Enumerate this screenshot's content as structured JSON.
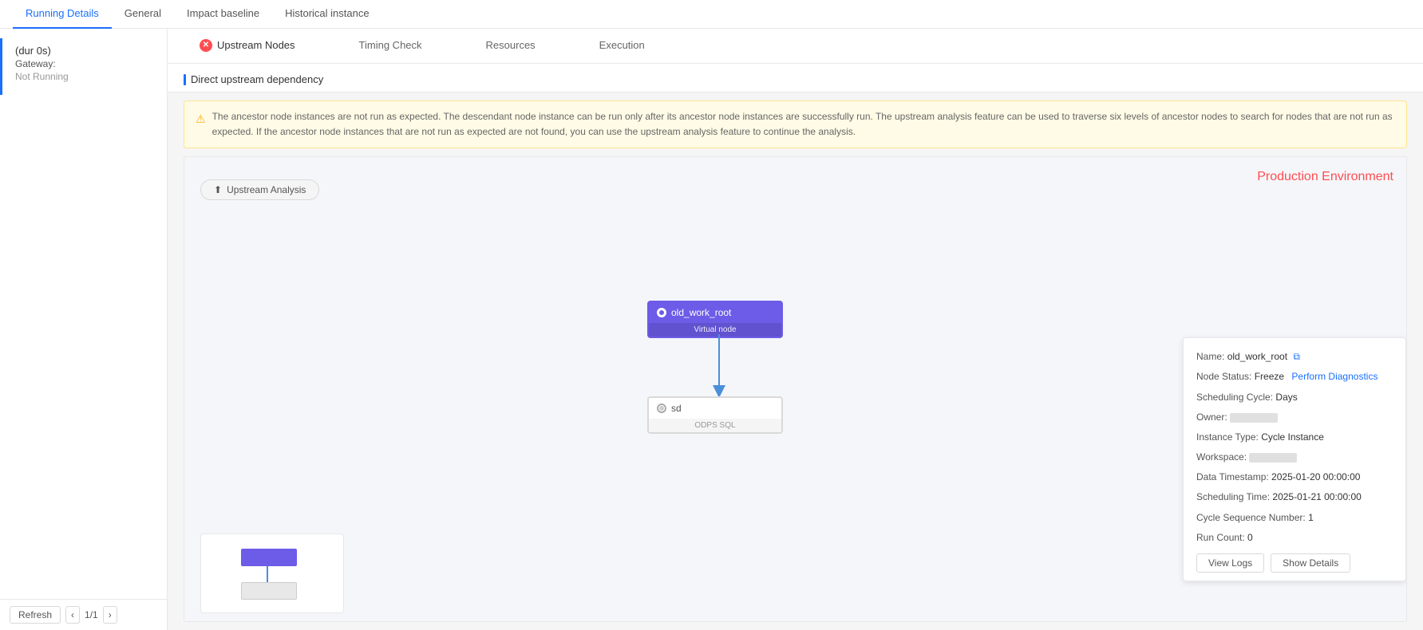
{
  "tabs": {
    "top": [
      {
        "label": "Running Details",
        "active": true
      },
      {
        "label": "General",
        "active": false
      },
      {
        "label": "Impact baseline",
        "active": false
      },
      {
        "label": "Historical instance",
        "active": false
      }
    ],
    "sub": [
      {
        "label": "Upstream Nodes",
        "active": true,
        "error": true
      },
      {
        "label": "Timing Check",
        "active": false
      },
      {
        "label": "Resources",
        "active": false
      },
      {
        "label": "Execution",
        "active": false
      }
    ]
  },
  "sidebar": {
    "dur": "(dur 0s)",
    "gateway_label": "Gateway:",
    "status": "Not Running",
    "refresh": "Refresh",
    "page": "1/1"
  },
  "dependency": {
    "section_label": "Direct upstream dependency"
  },
  "warning": {
    "text": "The ancestor node instances are not run as expected. The descendant node instance can be run only after its ancestor node instances are successfully run. The upstream analysis feature can be used to traverse six levels of ancestor nodes to search for nodes that are not run as expected. If the ancestor node instances that are not run as expected are not found, you can use the upstream analysis feature to continue the analysis."
  },
  "graph": {
    "upstream_btn": "Upstream Analysis",
    "prod_label": "Production Environment",
    "node1": {
      "name": "old_work_root",
      "type": "Virtual node"
    },
    "node2": {
      "name": "sd",
      "type": "ODPS SQL"
    }
  },
  "detail": {
    "name_label": "Name:",
    "name_val": "old_work_root",
    "node_status_label": "Node Status:",
    "node_status_val": "Freeze",
    "diagnose_link": "Perform Diagnostics",
    "sched_cycle_label": "Scheduling Cycle:",
    "sched_cycle_val": "Days",
    "owner_label": "Owner:",
    "instance_type_label": "Instance Type:",
    "instance_type_val": "Cycle Instance",
    "workspace_label": "Workspace:",
    "data_ts_label": "Data Timestamp:",
    "data_ts_val": "2025-01-20 00:00:00",
    "sched_time_label": "Scheduling Time:",
    "sched_time_val": "2025-01-21 00:00:00",
    "cycle_seq_label": "Cycle Sequence Number:",
    "cycle_seq_val": "1",
    "run_count_label": "Run Count:",
    "run_count_val": "0",
    "view_logs_btn": "View Logs",
    "show_details_btn": "Show Details"
  }
}
